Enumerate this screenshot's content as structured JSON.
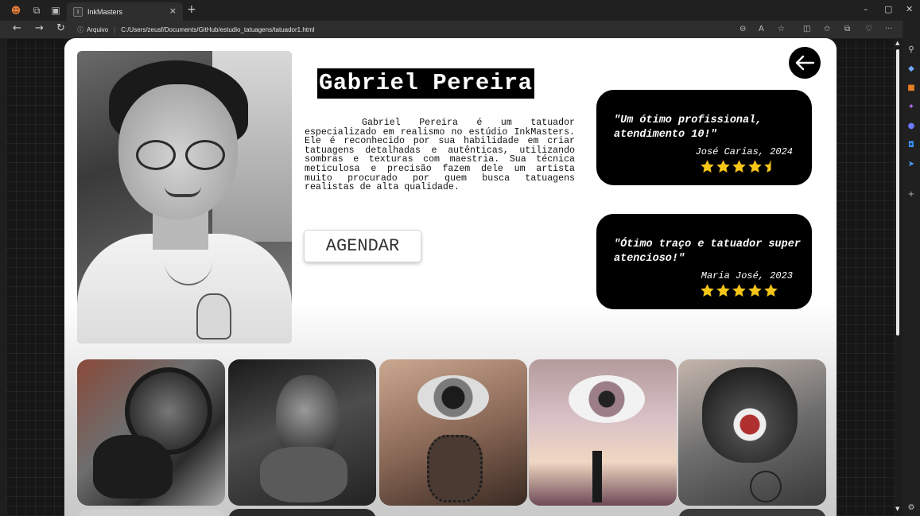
{
  "browser": {
    "tab_title": "InkMasters",
    "tab_close": "×",
    "new_tab": "+",
    "address_label": "Arquivo",
    "address_url": "C:/Users/zeusf/Documents/GitHub/estudio_tatuagens/tatuador1.html",
    "window_controls": [
      "–",
      "▢",
      "✕"
    ]
  },
  "profile": {
    "name": "Gabriel Pereira",
    "bio": "Gabriel Pereira é um tatuador especializado em realismo no estúdio InkMasters. Ele é reconhecido por sua habilidade em criar tatuagens detalhadas e autênticas, utilizando sombras e texturas com maestria. Sua técnica meticulosa e precisão fazem dele um artista muito procurado por quem busca tatuagens realistas de alta qualidade.",
    "button_label": "AGENDAR"
  },
  "reviews": [
    {
      "quote": "\"Um ótimo profissional, atendimento 10!\"",
      "author": "José Carias, 2024",
      "rating": 4.5
    },
    {
      "quote": "\"Ótimo traço e tatuador super atencioso!\"",
      "author": "Maria José, 2023",
      "rating": 5
    }
  ],
  "gallery": {
    "items": [
      {
        "subject": "bear-compass-tattoo"
      },
      {
        "subject": "woman-face-tattoo"
      },
      {
        "subject": "eye-rosary-tattoo"
      },
      {
        "subject": "eye-palm-tree-tattoo"
      },
      {
        "subject": "tiger-compass-tattoo"
      }
    ]
  },
  "colors": {
    "review_bg": "#000000",
    "star": "#f5c518",
    "name_bg": "#000000"
  }
}
